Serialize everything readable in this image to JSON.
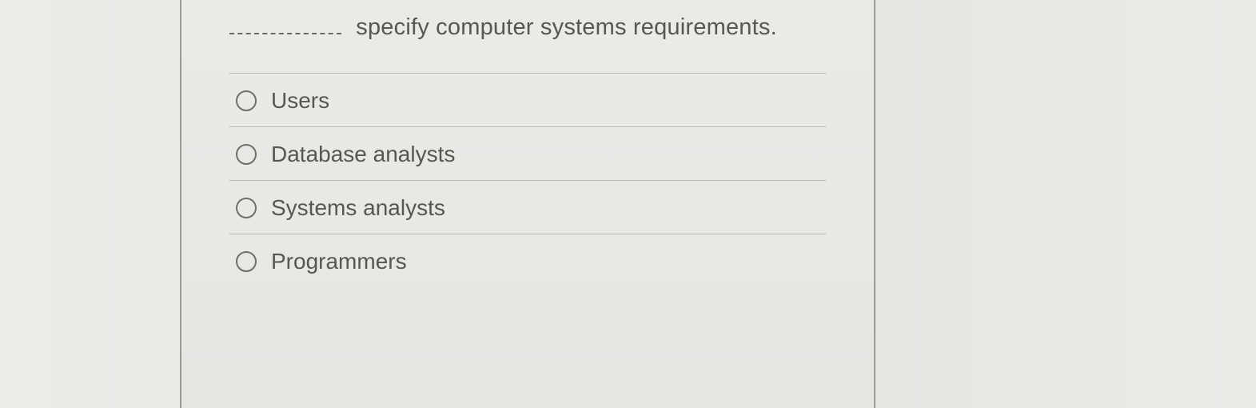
{
  "question": {
    "blank": "________",
    "stem_suffix": "specify computer systems requirements."
  },
  "options": [
    {
      "label": "Users"
    },
    {
      "label": "Database analysts"
    },
    {
      "label": "Systems analysts"
    },
    {
      "label": "Programmers"
    }
  ]
}
